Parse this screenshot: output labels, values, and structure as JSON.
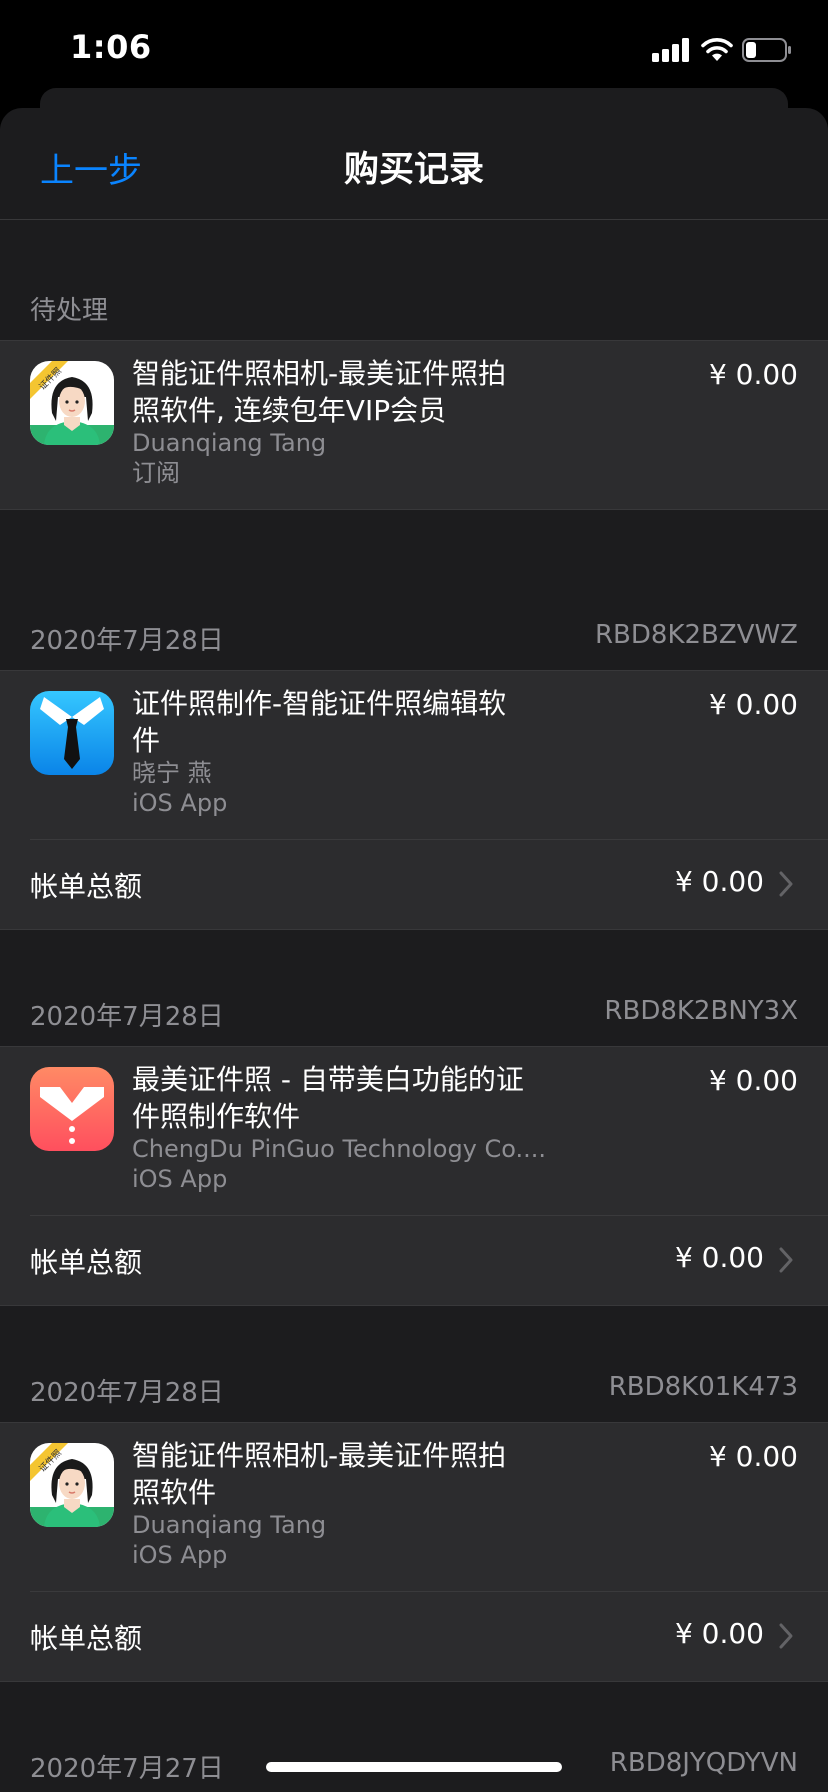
{
  "status_bar": {
    "time": "1:06"
  },
  "nav": {
    "back_label": "上一步",
    "title": "购买记录"
  },
  "pending": {
    "header": "待处理",
    "item": {
      "icon": "id-photo-camera-app-icon",
      "icon_badge": "证件照",
      "title": "智能证件照相机-最美证件照拍照软件, 连续包年VIP会员",
      "developer": "Duanqiang Tang",
      "type": "订阅",
      "price": "¥ 0.00"
    }
  },
  "orders": [
    {
      "date": "2020年7月28日",
      "order_id": "RBD8K2BZVWZ",
      "item": {
        "icon": "id-photo-maker-app-icon",
        "title": "证件照制作-智能证件照编辑软件",
        "developer": "晓宁 燕",
        "type": "iOS App",
        "price": "¥ 0.00"
      },
      "total_label": "帐单总额",
      "total": "¥ 0.00"
    },
    {
      "date": "2020年7月28日",
      "order_id": "RBD8K2BNY3X",
      "item": {
        "icon": "meimei-id-photo-app-icon",
        "title": "最美证件照 - 自带美白功能的证件照制作软件",
        "developer": "ChengDu PinGuo Technology Co....",
        "type": "iOS App",
        "price": "¥ 0.00"
      },
      "total_label": "帐单总额",
      "total": "¥ 0.00"
    },
    {
      "date": "2020年7月28日",
      "order_id": "RBD8K01K473",
      "item": {
        "icon": "id-photo-camera-app-icon",
        "icon_badge": "证件照",
        "title": "智能证件照相机-最美证件照拍照软件",
        "developer": "Duanqiang Tang",
        "type": "iOS App",
        "price": "¥ 0.00"
      },
      "total_label": "帐单总额",
      "total": "¥ 0.00"
    }
  ],
  "partial_next": {
    "date": "2020年7月27日",
    "order_id": "RBD8JYQDYVN"
  },
  "colors": {
    "accent": "#0a84ff",
    "background": "#1c1c1e",
    "cell": "#2c2c2e",
    "secondary_text": "#8e8e93"
  }
}
